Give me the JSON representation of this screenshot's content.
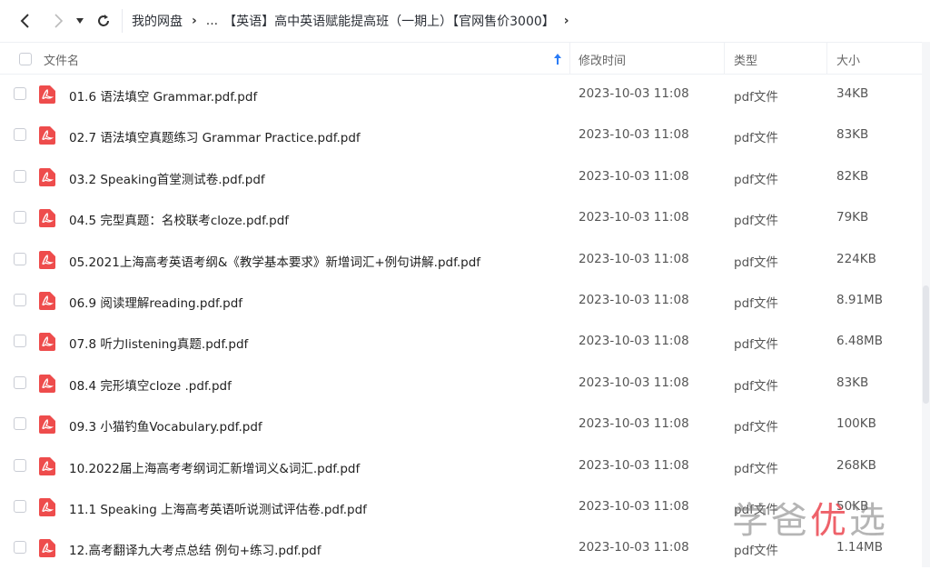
{
  "toolbar": {
    "breadcrumb_root": "我的网盘",
    "breadcrumb_ellipsis": "...",
    "breadcrumb_current": "【英语】高中英语赋能提高班（一期上）【官网售价3000】"
  },
  "table": {
    "headers": {
      "name": "文件名",
      "time": "修改时间",
      "type": "类型",
      "size": "大小"
    },
    "rows": [
      {
        "name": "01.6 语法填空 Grammar.pdf.pdf",
        "time": "2023-10-03 11:08",
        "type": "pdf文件",
        "size": "34KB"
      },
      {
        "name": "02.7 语法填空真题练习 Grammar Practice.pdf.pdf",
        "time": "2023-10-03 11:08",
        "type": "pdf文件",
        "size": "83KB"
      },
      {
        "name": "03.2 Speaking首堂测试卷.pdf.pdf",
        "time": "2023-10-03 11:08",
        "type": "pdf文件",
        "size": "82KB"
      },
      {
        "name": "04.5 完型真题：名校联考cloze.pdf.pdf",
        "time": "2023-10-03 11:08",
        "type": "pdf文件",
        "size": "79KB"
      },
      {
        "name": "05.2021上海高考英语考纲&《教学基本要求》新增词汇+例句讲解.pdf.pdf",
        "time": "2023-10-03 11:08",
        "type": "pdf文件",
        "size": "224KB"
      },
      {
        "name": "06.9 阅读理解reading.pdf.pdf",
        "time": "2023-10-03 11:08",
        "type": "pdf文件",
        "size": "8.91MB"
      },
      {
        "name": "07.8 听力listening真题.pdf.pdf",
        "time": "2023-10-03 11:08",
        "type": "pdf文件",
        "size": "6.48MB"
      },
      {
        "name": "08.4 完形填空cloze .pdf.pdf",
        "time": "2023-10-03 11:08",
        "type": "pdf文件",
        "size": "83KB"
      },
      {
        "name": "09.3 小猫钓鱼Vocabulary.pdf.pdf",
        "time": "2023-10-03 11:08",
        "type": "pdf文件",
        "size": "100KB"
      },
      {
        "name": "10.2022届上海高考考纲词汇新增词义&词汇.pdf.pdf",
        "time": "2023-10-03 11:08",
        "type": "pdf文件",
        "size": "268KB"
      },
      {
        "name": "11.1 Speaking 上海高考英语听说测试评估卷.pdf.pdf",
        "time": "2023-10-03 11:08",
        "type": "pdf文件",
        "size": "50KB"
      },
      {
        "name": "12.高考翻译九大考点总结 例句+练习.pdf.pdf",
        "time": "2023-10-03 11:08",
        "type": "pdf文件",
        "size": "1.14MB"
      }
    ]
  },
  "watermark": {
    "part1": "学爸",
    "part2": "优",
    "part3": "选"
  },
  "colors": {
    "pdf_icon": "#ee4c4c",
    "sort_arrow": "#2b7cf6"
  }
}
